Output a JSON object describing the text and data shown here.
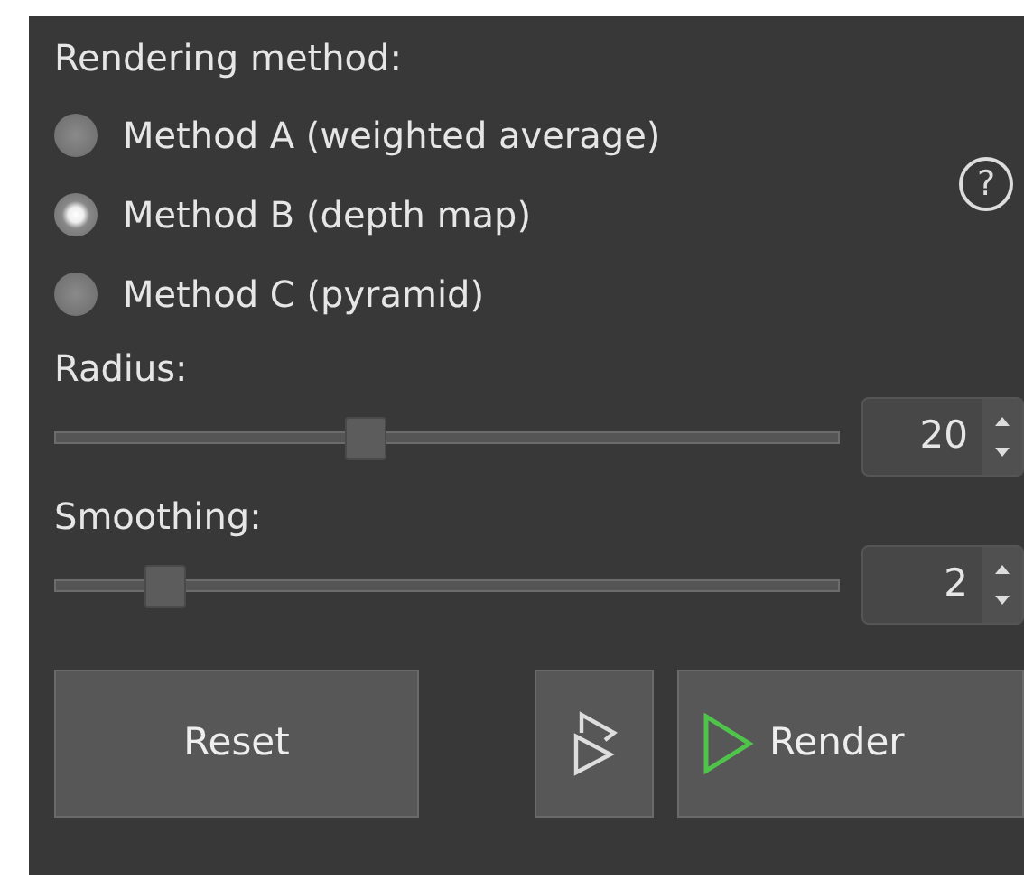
{
  "method_group": {
    "label": "Rendering method:",
    "options": [
      {
        "label": "Method A (weighted average)",
        "selected": false
      },
      {
        "label": "Method B (depth map)",
        "selected": true
      },
      {
        "label": "Method C (pyramid)",
        "selected": false
      }
    ],
    "help": "?"
  },
  "sliders": [
    {
      "label": "Radius:",
      "level": 0.39,
      "value": "20"
    },
    {
      "label": "Smoothing:",
      "level": 0.12,
      "value": "2"
    }
  ],
  "buttons": {
    "reset": "Reset",
    "render": "Render"
  }
}
